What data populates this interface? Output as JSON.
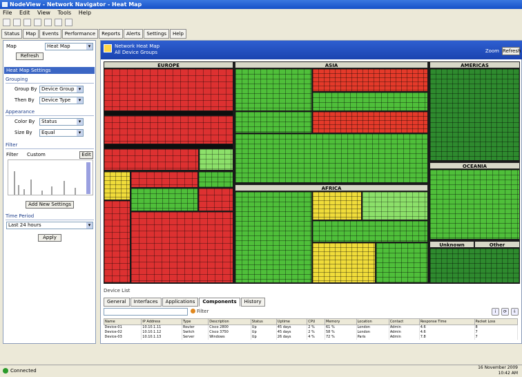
{
  "window": {
    "title": "NodeView - Network Navigator - Heat Map"
  },
  "menu": [
    "File",
    "Edit",
    "View",
    "Tools",
    "Help"
  ],
  "tabs": [
    "Status",
    "Map",
    "Events",
    "Performance",
    "Reports",
    "Alerts",
    "Settings",
    "Help"
  ],
  "left": {
    "map_label": "Map",
    "map_value": "Heat Map",
    "refresh": "Refresh",
    "section": "Heat Map Settings",
    "group1": "Grouping",
    "group_by_label": "Group By",
    "group_by_value": "Device Group",
    "then_by_label": "Then By",
    "then_by_value": "Device Type",
    "group2": "Appearance",
    "color_by_label": "Color By",
    "color_by_value": "Status",
    "size_by_label": "Size By",
    "size_by_value": "Equal",
    "group3": "Filter",
    "filter_label": "Filter",
    "filter_value": "Custom",
    "edit": "Edit",
    "add_button": "Add New Settings",
    "range_label": "Time Period",
    "range_value": "Last 24 hours",
    "apply": "Apply"
  },
  "main": {
    "title": "Network Heat Map",
    "subtitle": "All Device Groups",
    "zoom_label": "Zoom",
    "refresh": "Refresh",
    "groups": {
      "g1": "EUROPE",
      "g2": "ASIA",
      "g3": "AMERICAS",
      "g4": "AFRICA",
      "g5": "OCEANIA",
      "g6": "Unknown",
      "g7": "Other"
    }
  },
  "details": {
    "title": "Device List",
    "tabs": [
      "General",
      "Interfaces",
      "Applications",
      "Components",
      "History"
    ],
    "active_tab": "Components",
    "filter": "Filter",
    "columns": [
      "Name",
      "IP Address",
      "Type",
      "Description",
      "Status",
      "Uptime",
      "CPU",
      "Memory",
      "Location",
      "Contact",
      "Response Time",
      "Packet Loss"
    ],
    "rows": [
      [
        "Device-01",
        "10.10.1.11",
        "Router",
        "Cisco 2800",
        "Up",
        "45 days",
        "2 %",
        "61 %",
        "London",
        "Admin",
        "4.6",
        "8"
      ],
      [
        "Device-02",
        "10.10.1.12",
        "Switch",
        "Cisco 3750",
        "Up",
        "45 days",
        "2 %",
        "58 %",
        "London",
        "Admin",
        "4.6",
        "7"
      ],
      [
        "Device-03",
        "10.10.1.13",
        "Server",
        "Windows",
        "Up",
        "26 days",
        "4 %",
        "72 %",
        "Paris",
        "Admin",
        "7.8",
        "7"
      ]
    ]
  },
  "status": {
    "text": "Connected",
    "date": "16 November 2009",
    "time": "10:42 AM"
  },
  "colors": {
    "critical": "#dd3131",
    "warning": "#f0dc3a",
    "ok": "#4fbf3a",
    "ok_dark": "#2e8a2e",
    "accent": "#2e5fd0"
  },
  "icons": [
    "app-icon",
    "new-icon",
    "save-icon",
    "print-icon",
    "refresh-icon",
    "filter-icon",
    "chevron-down-icon"
  ]
}
